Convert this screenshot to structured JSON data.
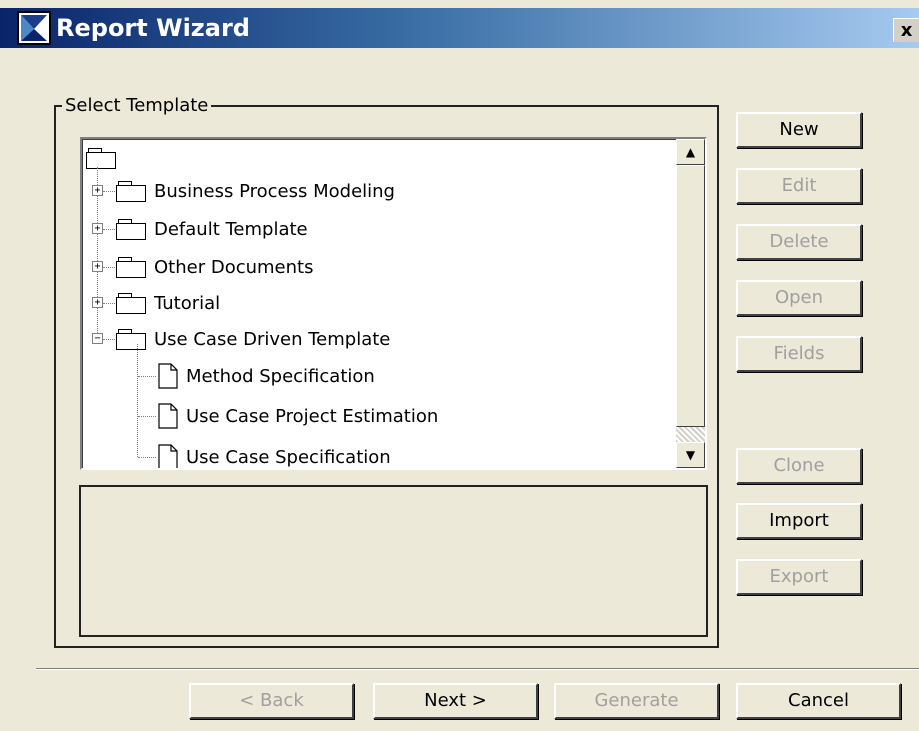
{
  "window": {
    "title": "Report Wizard",
    "close_glyph": "x"
  },
  "group": {
    "legend": "Select Template"
  },
  "tree": {
    "nodes": [
      {
        "label": "Business Process Modeling",
        "expander": "+"
      },
      {
        "label": "Default Template",
        "expander": "+"
      },
      {
        "label": "Other Documents",
        "expander": "+"
      },
      {
        "label": "Tutorial",
        "expander": "+"
      },
      {
        "label": "Use Case Driven Template",
        "expander": "−"
      }
    ],
    "children": [
      {
        "label": "Method Specification"
      },
      {
        "label": "Use Case Project Estimation"
      },
      {
        "label": "Use Case Specification"
      }
    ]
  },
  "scrollbar": {
    "up_glyph": "▲",
    "down_glyph": "▼"
  },
  "buttons": {
    "new": "New",
    "edit": "Edit",
    "delete": "Delete",
    "open": "Open",
    "fields": "Fields",
    "clone": "Clone",
    "import": "Import",
    "export": "Export",
    "back": "< Back",
    "next": "Next >",
    "generate": "Generate",
    "cancel": "Cancel"
  }
}
